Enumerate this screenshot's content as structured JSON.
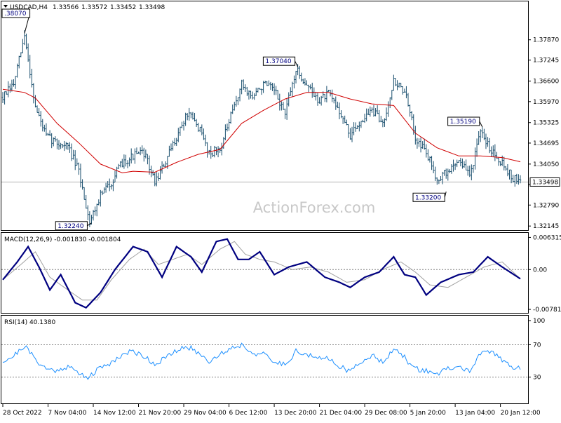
{
  "chart_data": [
    {
      "type": "candlestick",
      "symbol": "USDCAD,H4",
      "header_values": [
        "1.33566",
        "1.33572",
        "1.33452",
        "1.33498"
      ],
      "price_axis_ticks": [
        "1.37870",
        "1.37245",
        "1.36600",
        "1.35970",
        "1.35325",
        "1.34695",
        "1.34050",
        "1.33420",
        "1.32790",
        "1.32145"
      ],
      "ylim": [
        1.3202,
        1.3905
      ],
      "current_price": "1.33498",
      "moving_average_color": "#d00000",
      "bar_color": "#1a4f6e",
      "annotations": [
        {
          "label": ".38070",
          "value": 1.3807,
          "bar": 12
        },
        {
          "label": "1.32240",
          "value": 1.3224,
          "bar": 49
        },
        {
          "label": "1.37040",
          "value": 1.3704,
          "bar": 163
        },
        {
          "label": "1.35190",
          "value": 1.3519,
          "bar": 265
        },
        {
          "label": "1.33200",
          "value": 1.332,
          "bar": 245
        }
      ],
      "close_path": [
        [
          0,
          1.361
        ],
        [
          6,
          1.365
        ],
        [
          12,
          1.3797
        ],
        [
          18,
          1.358
        ],
        [
          24,
          1.349
        ],
        [
          30,
          1.347
        ],
        [
          36,
          1.346
        ],
        [
          42,
          1.338
        ],
        [
          48,
          1.3228
        ],
        [
          54,
          1.331
        ],
        [
          60,
          1.335
        ],
        [
          66,
          1.341
        ],
        [
          72,
          1.343
        ],
        [
          78,
          1.344
        ],
        [
          84,
          1.335
        ],
        [
          90,
          1.341
        ],
        [
          96,
          1.349
        ],
        [
          102,
          1.356
        ],
        [
          108,
          1.352
        ],
        [
          114,
          1.344
        ],
        [
          120,
          1.345
        ],
        [
          126,
          1.355
        ],
        [
          132,
          1.365
        ],
        [
          138,
          1.361
        ],
        [
          144,
          1.365
        ],
        [
          150,
          1.363
        ],
        [
          156,
          1.356
        ],
        [
          162,
          1.3695
        ],
        [
          168,
          1.365
        ],
        [
          174,
          1.36
        ],
        [
          180,
          1.362
        ],
        [
          186,
          1.357
        ],
        [
          192,
          1.349
        ],
        [
          198,
          1.354
        ],
        [
          204,
          1.357
        ],
        [
          210,
          1.353
        ],
        [
          216,
          1.366
        ],
        [
          222,
          1.363
        ],
        [
          228,
          1.349
        ],
        [
          234,
          1.344
        ],
        [
          240,
          1.336
        ],
        [
          246,
          1.338
        ],
        [
          252,
          1.342
        ],
        [
          258,
          1.337
        ],
        [
          264,
          1.35
        ],
        [
          270,
          1.345
        ],
        [
          276,
          1.341
        ],
        [
          282,
          1.336
        ],
        [
          286,
          1.335
        ]
      ],
      "moving_average": [
        [
          0,
          1.3635
        ],
        [
          12,
          1.3625
        ],
        [
          18,
          1.3608
        ],
        [
          30,
          1.353
        ],
        [
          42,
          1.347
        ],
        [
          54,
          1.3405
        ],
        [
          66,
          1.3378
        ],
        [
          72,
          1.3383
        ],
        [
          84,
          1.338
        ],
        [
          96,
          1.341
        ],
        [
          108,
          1.3435
        ],
        [
          120,
          1.345
        ],
        [
          132,
          1.353
        ],
        [
          144,
          1.357
        ],
        [
          156,
          1.3605
        ],
        [
          168,
          1.3625
        ],
        [
          180,
          1.3625
        ],
        [
          192,
          1.3605
        ],
        [
          204,
          1.359
        ],
        [
          216,
          1.3585
        ],
        [
          228,
          1.35
        ],
        [
          240,
          1.3455
        ],
        [
          252,
          1.343
        ],
        [
          264,
          1.343
        ],
        [
          276,
          1.3425
        ],
        [
          286,
          1.3412
        ]
      ],
      "x_axis_labels": [
        {
          "label": "28 Oct 2022",
          "bar": 0
        },
        {
          "label": "7 Nov 04:00",
          "bar": 25
        },
        {
          "label": "14 Nov 12:00",
          "bar": 50
        },
        {
          "label": "21 Nov 20:00",
          "bar": 75
        },
        {
          "label": "29 Nov 04:00",
          "bar": 100
        },
        {
          "label": "6 Dec 12:00",
          "bar": 125
        },
        {
          "label": "13 Dec 20:00",
          "bar": 150
        },
        {
          "label": "21 Dec 04:00",
          "bar": 175
        },
        {
          "label": "29 Dec 08:00",
          "bar": 200
        },
        {
          "label": "5 Jan 20:00",
          "bar": 225
        },
        {
          "label": "13 Jan 04:00",
          "bar": 250
        },
        {
          "label": "20 Jan 12:00",
          "bar": 275
        }
      ],
      "bar_count": 287
    },
    {
      "type": "line",
      "name": "MACD(12,26,9) -0.001830 -0.001804",
      "axis_ticks": [
        "0.006315",
        "0.00",
        "-0.007818"
      ],
      "ylim": [
        -0.0085,
        0.0072
      ],
      "zero_line": 0,
      "series": [
        {
          "role": "macd",
          "color": "#000080",
          "points": [
            [
              0,
              -0.002
            ],
            [
              8,
              0.0015
            ],
            [
              14,
              0.0045
            ],
            [
              20,
              0.0005
            ],
            [
              26,
              -0.004
            ],
            [
              32,
              -0.001
            ],
            [
              40,
              -0.0065
            ],
            [
              46,
              -0.0075
            ],
            [
              54,
              -0.0045
            ],
            [
              62,
              0.0
            ],
            [
              72,
              0.0045
            ],
            [
              80,
              0.0035
            ],
            [
              88,
              -0.0015
            ],
            [
              96,
              0.0045
            ],
            [
              104,
              0.0025
            ],
            [
              110,
              -0.0005
            ],
            [
              118,
              0.0055
            ],
            [
              124,
              0.006
            ],
            [
              130,
              0.002
            ],
            [
              136,
              0.002
            ],
            [
              142,
              0.0035
            ],
            [
              150,
              -0.001
            ],
            [
              158,
              0.0005
            ],
            [
              168,
              0.0015
            ],
            [
              178,
              -0.0015
            ],
            [
              186,
              -0.0025
            ],
            [
              192,
              -0.0035
            ],
            [
              200,
              -0.0015
            ],
            [
              208,
              -0.0005
            ],
            [
              216,
              0.0025
            ],
            [
              222,
              -0.001
            ],
            [
              228,
              -0.0015
            ],
            [
              234,
              -0.005
            ],
            [
              242,
              -0.0025
            ],
            [
              252,
              -0.001
            ],
            [
              260,
              -0.0005
            ],
            [
              268,
              0.0025
            ],
            [
              276,
              0.0005
            ],
            [
              286,
              -0.0018
            ]
          ]
        },
        {
          "role": "signal",
          "color": "#a0a0a0",
          "points": [
            [
              0,
              -0.002
            ],
            [
              10,
              0.001
            ],
            [
              18,
              0.0035
            ],
            [
              26,
              -0.0015
            ],
            [
              34,
              -0.0035
            ],
            [
              44,
              -0.006
            ],
            [
              52,
              -0.006
            ],
            [
              60,
              -0.002
            ],
            [
              70,
              0.002
            ],
            [
              78,
              0.004
            ],
            [
              86,
              0.001
            ],
            [
              94,
              0.002
            ],
            [
              102,
              0.003
            ],
            [
              110,
              0.001
            ],
            [
              120,
              0.004
            ],
            [
              128,
              0.0055
            ],
            [
              134,
              0.003
            ],
            [
              142,
              0.002
            ],
            [
              150,
              0.0015
            ],
            [
              160,
              0.0
            ],
            [
              170,
              0.0005
            ],
            [
              180,
              -0.0005
            ],
            [
              190,
              -0.0025
            ],
            [
              200,
              -0.002
            ],
            [
              210,
              0.0
            ],
            [
              220,
              0.0015
            ],
            [
              228,
              -0.0005
            ],
            [
              236,
              -0.003
            ],
            [
              246,
              -0.0035
            ],
            [
              256,
              -0.0015
            ],
            [
              266,
              0.0005
            ],
            [
              276,
              0.0015
            ],
            [
              286,
              -0.0018
            ]
          ]
        }
      ]
    },
    {
      "type": "line",
      "name": "RSI(14) 40.1380",
      "axis_ticks": [
        "100",
        "70",
        "30"
      ],
      "ylim": [
        0,
        100
      ],
      "levels": [
        70,
        30
      ],
      "series": [
        {
          "role": "rsi",
          "color": "#1e90ff",
          "points": [
            [
              0,
              50
            ],
            [
              6,
              56
            ],
            [
              12,
              69
            ],
            [
              18,
              52
            ],
            [
              24,
              40
            ],
            [
              30,
              38
            ],
            [
              36,
              44
            ],
            [
              42,
              34
            ],
            [
              48,
              30
            ],
            [
              54,
              42
            ],
            [
              60,
              48
            ],
            [
              66,
              58
            ],
            [
              72,
              62
            ],
            [
              78,
              56
            ],
            [
              84,
              46
            ],
            [
              90,
              54
            ],
            [
              96,
              62
            ],
            [
              102,
              68
            ],
            [
              108,
              60
            ],
            [
              114,
              50
            ],
            [
              120,
              58
            ],
            [
              126,
              66
            ],
            [
              132,
              70
            ],
            [
              138,
              60
            ],
            [
              144,
              58
            ],
            [
              150,
              48
            ],
            [
              156,
              46
            ],
            [
              162,
              62
            ],
            [
              168,
              58
            ],
            [
              174,
              52
            ],
            [
              180,
              54
            ],
            [
              186,
              44
            ],
            [
              192,
              36
            ],
            [
              198,
              50
            ],
            [
              204,
              56
            ],
            [
              210,
              50
            ],
            [
              216,
              64
            ],
            [
              222,
              54
            ],
            [
              228,
              40
            ],
            [
              234,
              38
            ],
            [
              240,
              34
            ],
            [
              246,
              40
            ],
            [
              252,
              42
            ],
            [
              258,
              38
            ],
            [
              264,
              58
            ],
            [
              270,
              62
            ],
            [
              276,
              52
            ],
            [
              282,
              42
            ],
            [
              286,
              40
            ]
          ]
        }
      ]
    }
  ],
  "watermark": "ActionForex.com"
}
